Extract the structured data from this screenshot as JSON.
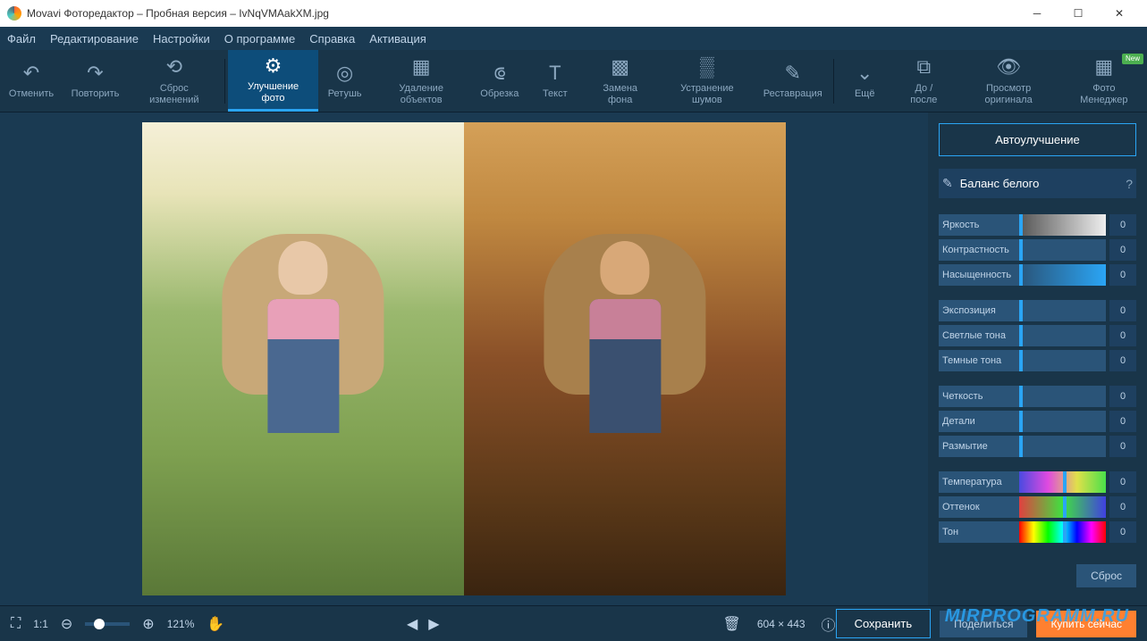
{
  "titlebar": {
    "title": "Movavi Фоторедактор – Пробная версия – IvNqVMAakXM.jpg"
  },
  "menubar": [
    "Файл",
    "Редактирование",
    "Настройки",
    "О программе",
    "Справка",
    "Активация"
  ],
  "toolbar": {
    "undo": "Отменить",
    "redo": "Повторить",
    "reset": "Сброс изменений",
    "enhance": "Улучшение фото",
    "retouch": "Ретушь",
    "remove": "Удаление объектов",
    "crop": "Обрезка",
    "text": "Текст",
    "bg": "Замена фона",
    "noise": "Устранение шумов",
    "restore": "Реставрация",
    "more": "Ещё",
    "compare": "До / после",
    "original": "Просмотр оригинала",
    "manager": "Фото Менеджер",
    "new_badge": "New"
  },
  "panel": {
    "auto": "Автоулучшение",
    "wb": "Баланс белого",
    "sliders": {
      "brightness": "Яркость",
      "contrast": "Контрастность",
      "saturation": "Насыщенность",
      "exposure": "Экспозиция",
      "highlights": "Светлые тона",
      "shadows": "Темные тона",
      "sharpness": "Четкость",
      "details": "Детали",
      "blur": "Размытие",
      "temperature": "Температура",
      "tint": "Оттенок",
      "hue": "Тон"
    },
    "val": "0",
    "reset": "Сброс"
  },
  "statusbar": {
    "fit": "1:1",
    "zoom": "121%",
    "dims": "604 × 443",
    "save": "Сохранить",
    "share": "Поделиться",
    "buy": "Купить сейчас"
  },
  "watermark": "MIRPROGRAMM.RU"
}
